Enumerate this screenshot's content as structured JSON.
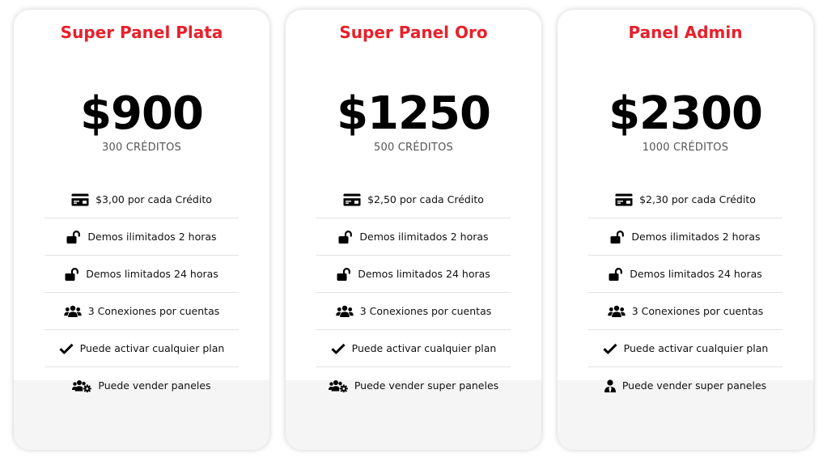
{
  "accent_color": "#e8202a",
  "plans": [
    {
      "title": "Super Panel Plata",
      "price": "$900",
      "credits": "300 CRÉDITOS",
      "features": [
        {
          "icon": "credit-card-icon",
          "text": "$3,00 por cada Crédito"
        },
        {
          "icon": "unlock-icon",
          "text": "Demos ilimitados 2 horas"
        },
        {
          "icon": "unlock-icon",
          "text": "Demos limitados 24 horas"
        },
        {
          "icon": "users-icon",
          "text": "3 Conexiones por cuentas"
        },
        {
          "icon": "check-icon",
          "text": "Puede activar cualquier plan"
        },
        {
          "icon": "users-gear-icon",
          "text": "Puede vender paneles"
        }
      ]
    },
    {
      "title": "Super Panel Oro",
      "price": "$1250",
      "credits": "500 CRÉDITOS",
      "features": [
        {
          "icon": "credit-card-icon",
          "text": "$2,50 por cada Crédito"
        },
        {
          "icon": "unlock-icon",
          "text": "Demos ilimitados 2 horas"
        },
        {
          "icon": "unlock-icon",
          "text": "Demos limitados 24 horas"
        },
        {
          "icon": "users-icon",
          "text": "3 Conexiones por cuentas"
        },
        {
          "icon": "check-icon",
          "text": "Puede activar cualquier plan"
        },
        {
          "icon": "users-gear-icon",
          "text": "Puede vender super paneles"
        }
      ]
    },
    {
      "title": "Panel Admin",
      "price": "$2300",
      "credits": "1000 CRÉDITOS",
      "features": [
        {
          "icon": "credit-card-icon",
          "text": "$2,30 por cada Crédito"
        },
        {
          "icon": "unlock-icon",
          "text": "Demos ilimitados 2 horas"
        },
        {
          "icon": "unlock-icon",
          "text": "Demos limitados 24 horas"
        },
        {
          "icon": "users-icon",
          "text": "3 Conexiones por cuentas"
        },
        {
          "icon": "check-icon",
          "text": "Puede activar cualquier plan"
        },
        {
          "icon": "user-tie-icon",
          "text": "Puede vender super paneles"
        }
      ]
    }
  ]
}
